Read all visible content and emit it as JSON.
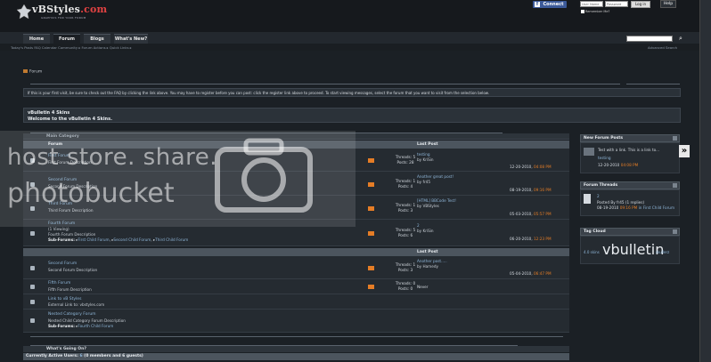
{
  "header": {
    "brand_main": "vBStyles",
    "brand_suffix": ".com",
    "tagline": "GRAPHICS FOR YOUR FORUM",
    "connect_label": "Connect",
    "facebook_letter": "f",
    "login_user_placeholder": "User Name",
    "login_pass_placeholder": "Password",
    "login_button": "Log in",
    "help_button": "Help",
    "remember_label": "Remember Me?"
  },
  "nav": {
    "tabs": [
      {
        "label": "Home"
      },
      {
        "label": "Forum"
      },
      {
        "label": "Blogs"
      },
      {
        "label": "What's New?"
      }
    ],
    "subnav_links": "Today's Posts   FAQ   Calendar   Community ▸   Forum Actions ▸   Quick Links ▸",
    "advanced_search": "Advanced Search",
    "search_glyph": "⌕"
  },
  "breadcrumb": "Forum",
  "notice": "If this is your first visit, be sure to check out the FAQ by clicking the link above. You may have to register before you can post: click the register link above to proceed. To start viewing messages, select the forum that you want to visit from the selection below.",
  "welcome": {
    "title": "vBulletin 4 Skins",
    "subtitle": "Welcome to the vBulletin 4 Skins."
  },
  "categories": [
    {
      "name": "Main Category",
      "col_forum": "Forum",
      "col_lastpost": "Last Post"
    }
  ],
  "second_header": {
    "col_lastpost": "Last Post"
  },
  "forums": [
    {
      "name": "First Forum",
      "desc": "First Forum Description",
      "stats1": "Threads: 5",
      "stats2": "Posts: 28",
      "lp_title": "testing",
      "lp_by": "by KriSin",
      "lp_date": "12-20-2010,",
      "lp_time": "04:08 PM"
    },
    {
      "name": "Second Forum",
      "desc": "Second Forum Description",
      "stats1": "Threads: 1",
      "stats2": "Posts: 4",
      "lp_title": "Another great post!",
      "lp_by": "by fr45",
      "lp_date": "08-19-2010,",
      "lp_time": "09:16 PM"
    },
    {
      "name": "Third Forum",
      "desc": "Third Forum Description",
      "stats1": "Threads: 1",
      "stats2": "Posts: 3",
      "lp_title": "[HTML] BBCode Test!",
      "lp_by": "by VBStyles",
      "lp_date": "05-03-2010,",
      "lp_time": "05:57 PM"
    },
    {
      "name": "Fourth Forum",
      "viewing": "(1 Viewing)",
      "desc": "Fourth Forum Description",
      "sub_label": "Sub-Forums:",
      "subs": [
        "First Child Forum",
        "Second Child Forum",
        "Third Child Forum"
      ],
      "stats1": "Threads: 5",
      "stats2": "Posts: 6",
      "lp_title": "2",
      "lp_by": "by KriSin",
      "lp_date": "06-20-2010,",
      "lp_time": "12:23 PM"
    },
    {
      "name": "Second Forum",
      "desc": "Second Forum Description",
      "stats1": "Threads: 1",
      "stats2": "Posts: 3",
      "lp_title": "Another post.....",
      "lp_by": "by Hamedy",
      "lp_date": "05-04-2010,",
      "lp_time": "06:47 PM"
    },
    {
      "name": "Fifth Forum",
      "desc": "Fifth Forum Description",
      "stats1": "Threads: 0",
      "stats2": "Posts: 0",
      "lp_never": "Never"
    },
    {
      "name": "Link to vB Styles",
      "desc": "External Link to: vbstyles.com"
    },
    {
      "name": "Nested Category Forum",
      "desc": "Nested Child Category Forum Description",
      "sub_label": "Sub-Forums:",
      "subs": [
        "Fourth Child Forum"
      ]
    }
  ],
  "sidebar": {
    "new_posts": {
      "title": "New Forum Posts",
      "post_title": "Test with a link. This is a link to...",
      "post_by": "testing",
      "post_date": "12-20-2010",
      "post_time": "04:08 PM"
    },
    "threads": {
      "title": "Forum Threads",
      "thread_title": "2",
      "thread_by": "Posted By fr45 (1 replies)",
      "thread_date": "08-19-2010",
      "thread_time": "09:16 PM",
      "thread_in": "in First Child Forum"
    },
    "tags": {
      "title": "Tag Cloud",
      "small1": "4.0 skins",
      "big": "vbulletin",
      "small2": "skullerz"
    }
  },
  "arrow_label": "»",
  "bottom": {
    "whats_going_on": "What's Going On?",
    "active_users_prefix": "Currently Active Users:",
    "active_users_count": "6",
    "active_users_detail": "(0 members and 6 guests)"
  },
  "watermark": {
    "line1": "host store. share.",
    "line2": "photobucket"
  },
  "colors": {
    "accent_orange": "#e57d26",
    "link_blue": "#8fb6d8",
    "brand_red": "#e04242",
    "facebook": "#3b5998"
  }
}
